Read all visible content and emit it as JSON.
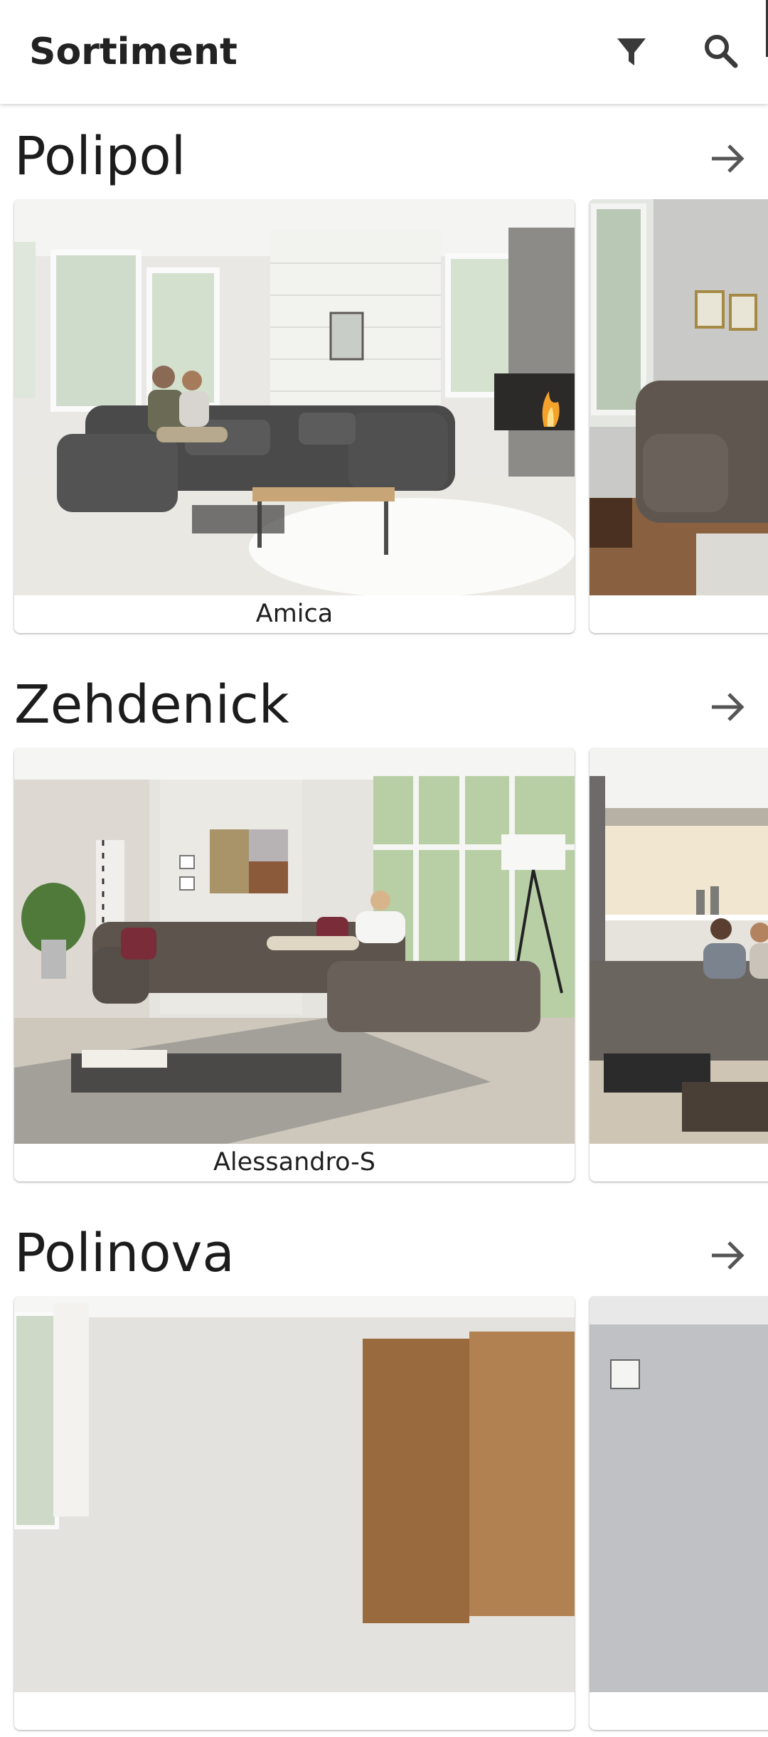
{
  "appbar": {
    "title": "Sortiment",
    "icons": [
      "filter-icon",
      "search-icon"
    ]
  },
  "sections": [
    {
      "title": "Polipol",
      "arrow_icon": "arrow-right-icon",
      "cards": [
        {
          "label": "Amica"
        },
        {
          "label": ""
        }
      ]
    },
    {
      "title": "Zehdenick",
      "arrow_icon": "arrow-right-icon",
      "cards": [
        {
          "label": "Alessandro-S"
        },
        {
          "label": ""
        }
      ]
    },
    {
      "title": "Polinova",
      "arrow_icon": "arrow-right-icon",
      "cards": [
        {
          "label": ""
        },
        {
          "label": ""
        }
      ]
    }
  ],
  "colors": {
    "background": "#ffffff",
    "icon": "#3c3c3c",
    "text": "#1f1f1f"
  }
}
